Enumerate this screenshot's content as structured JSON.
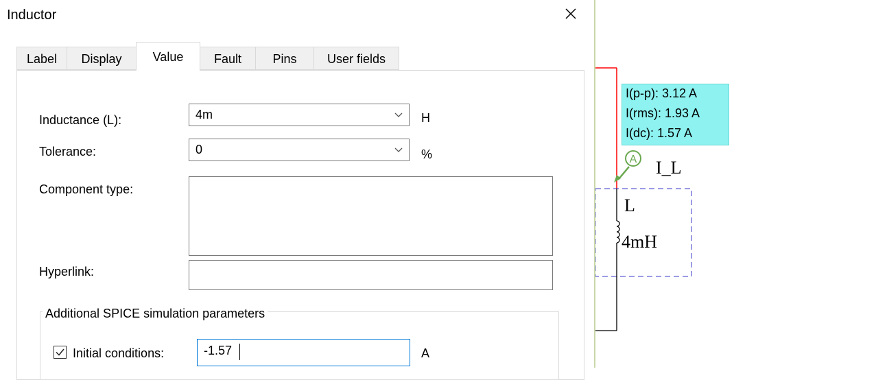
{
  "dialog": {
    "title": "Inductor",
    "tabs": [
      {
        "label": "Label",
        "active": false
      },
      {
        "label": "Display",
        "active": false
      },
      {
        "label": "Value",
        "active": true
      },
      {
        "label": "Fault",
        "active": false
      },
      {
        "label": "Pins",
        "active": false
      },
      {
        "label": "User fields",
        "active": false
      }
    ],
    "fields": {
      "inductance": {
        "label": "Inductance (L):",
        "value": "4m",
        "unit": "H"
      },
      "tolerance": {
        "label": "Tolerance:",
        "value": "0",
        "unit": "%"
      },
      "component_type": {
        "label": "Component type:",
        "value": ""
      },
      "hyperlink": {
        "label": "Hyperlink:",
        "value": ""
      }
    },
    "spice_group": {
      "title": "Additional SPICE simulation parameters",
      "initial_conditions": {
        "label": "Initial conditions:",
        "checked": true,
        "value": "-1.57",
        "unit": "A"
      }
    }
  },
  "schematic": {
    "probe": {
      "ipp": "I(p-p): 3.12 A",
      "irms": "I(rms): 1.93 A",
      "idc": "I(dc): 1.57 A",
      "symbol": "A",
      "name": "I_L"
    },
    "component": {
      "ref": "L",
      "value": "4mH"
    },
    "colors": {
      "wire_active": "#ff0000",
      "wire": "#000000",
      "selection": "#3a3acc",
      "probe": "#6aa84f",
      "tooltip_bg": "#8df2f0"
    }
  }
}
